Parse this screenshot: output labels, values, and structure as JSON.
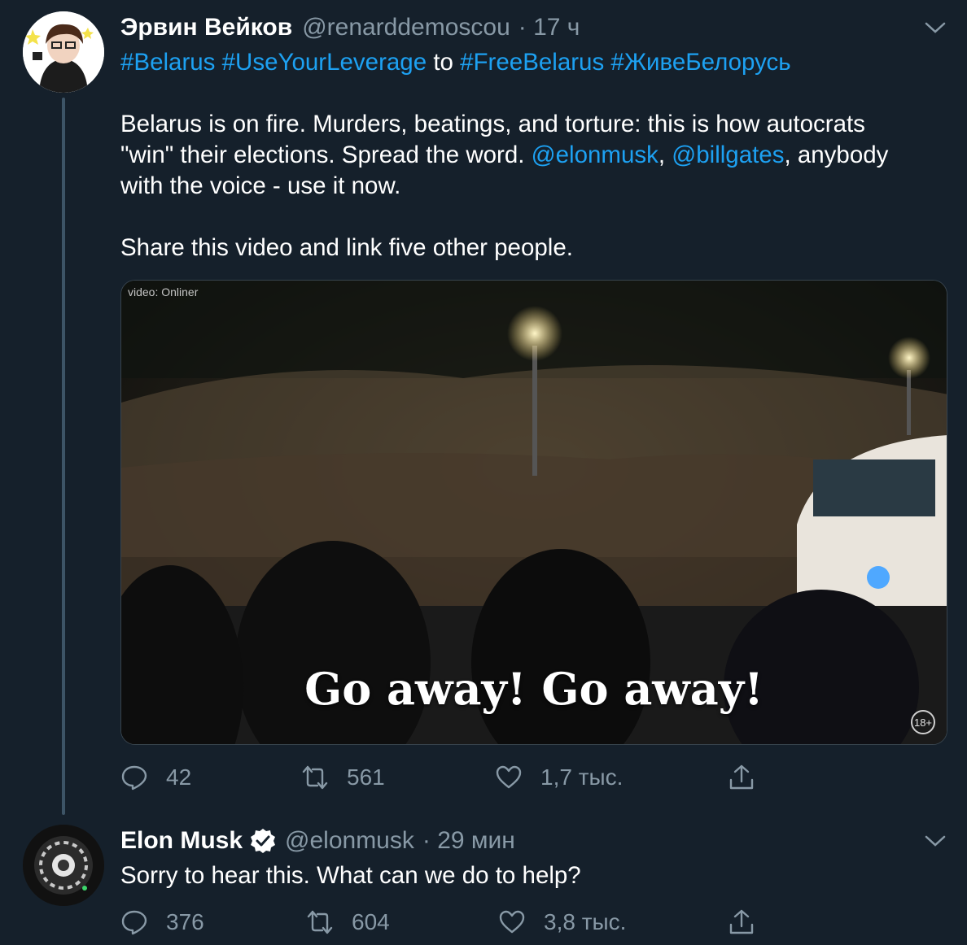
{
  "tweet1": {
    "display_name": "Эрвин Вейков",
    "handle": "@renarddemoscou",
    "time": "· 17 ч",
    "hashtags_line": [
      {
        "text": "#Belarus #UseYourLeverage",
        "link": true
      },
      {
        "text": " to ",
        "link": false
      },
      {
        "text": "#FreeBelarus #ЖивеБелорусь",
        "link": true
      }
    ],
    "para1_line1": "Belarus is on fire. Murders, beatings, and torture: this is how autocrats",
    "para1_line2_a": "\"win\" their elections. Spread the word. ",
    "mention1": "@elonmusk",
    "comma": ", ",
    "mention2": "@billgates",
    "para1_line2_b": ", anybody",
    "para1_line3": "with the voice - use it now.",
    "para2": "Share this video and link five other people.",
    "media": {
      "credit": "video: Onliner",
      "subtitle": "Go away! Go away!",
      "age_badge": "18+"
    },
    "replies": "42",
    "retweets": "561",
    "likes": "1,7 тыс."
  },
  "tweet2": {
    "display_name": "Elon Musk",
    "handle": "@elonmusk",
    "time": "· 29 мин",
    "text": "Sorry to hear this. What can we do to help?",
    "replies": "376",
    "retweets": "604",
    "likes": "3,8 тыс."
  },
  "colors": {
    "background": "#15202b",
    "link": "#1da1f2",
    "muted": "#8899a6"
  },
  "icons": [
    "reply-icon",
    "retweet-icon",
    "like-icon",
    "share-icon",
    "chevron-down-icon",
    "verified-badge-icon"
  ]
}
